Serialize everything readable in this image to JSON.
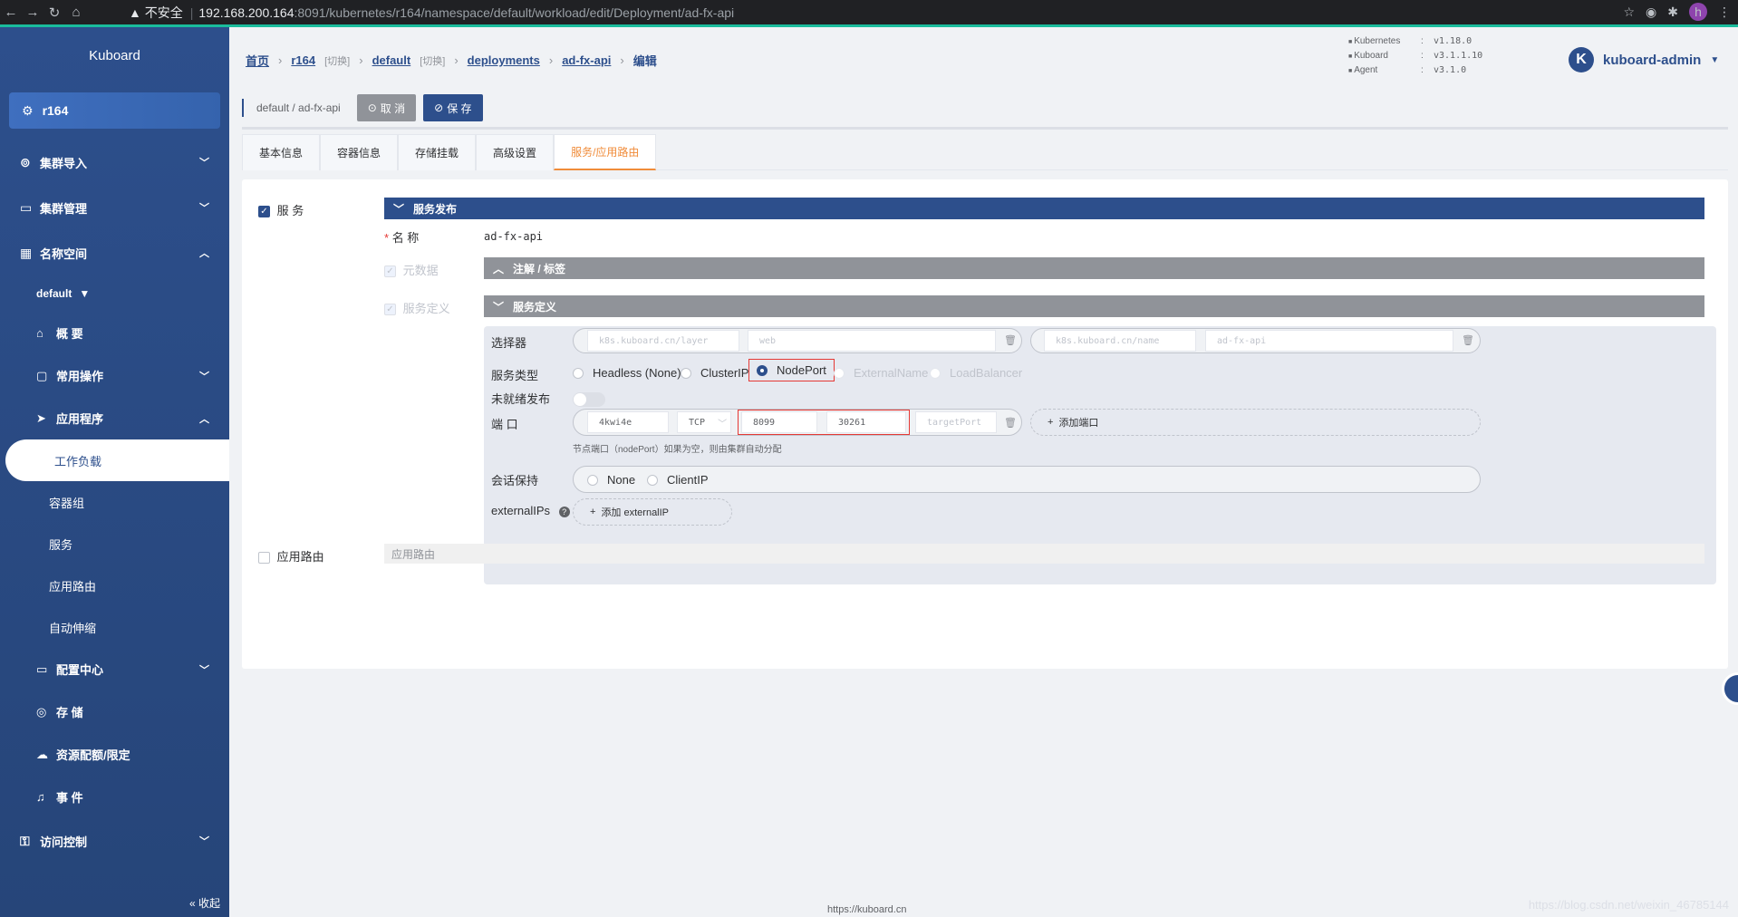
{
  "browser": {
    "back_icon": "arrow-left-icon",
    "forward_icon": "arrow-right-icon",
    "reload_icon": "reload-icon",
    "home_icon": "home-icon",
    "security_label": "不安全",
    "url_host": "192.168.200.164",
    "url_path": ":8091/kubernetes/r164/namespace/default/workload/edit/Deployment/ad-fx-api",
    "profile_initial": "h"
  },
  "sidebar": {
    "brand": "Kuboard",
    "cluster": "r164",
    "items": {
      "cluster_import": "集群导入",
      "cluster_manage": "集群管理",
      "namespace": "名称空间",
      "ns_current": "default",
      "overview": "概 要",
      "common_ops": "常用操作",
      "apps": "应用程序",
      "workload": "工作负载",
      "pods": "容器组",
      "services": "服务",
      "ingress": "应用路由",
      "autoscale": "自动伸缩",
      "config_center": "配置中心",
      "storage": "存 储",
      "quota": "资源配额/限定",
      "events": "事 件",
      "access_control": "访问控制",
      "collapse": "« 收起"
    }
  },
  "breadcrumb": {
    "home": "首页",
    "cluster": "r164",
    "switch_hint": "[切换]",
    "namespace": "default",
    "deployments": "deployments",
    "name": "ad-fx-api",
    "current": "编辑"
  },
  "versions": [
    {
      "k": "Kubernetes",
      "v": "v1.18.0"
    },
    {
      "k": "Kuboard",
      "v": "v3.1.1.10"
    },
    {
      "k": "Agent",
      "v": "v3.1.0"
    }
  ],
  "user": {
    "logo": "K",
    "name": "kuboard-admin"
  },
  "actions": {
    "path": "default / ad-fx-api",
    "cancel": "取 消",
    "save": "保 存"
  },
  "tabs": [
    "基本信息",
    "容器信息",
    "存储挂载",
    "高级设置",
    "服务/应用路由"
  ],
  "form": {
    "service_checkbox": "服 务",
    "service_publish": "服务发布",
    "name_label": "名 称",
    "name_value": "ad-fx-api",
    "metadata_label": "元数据",
    "annotations_header": "注解 / 标签",
    "svcdef_label": "服务定义",
    "svcdef_header": "服务定义",
    "selector_label": "选择器",
    "selector": [
      {
        "key": "k8s.kuboard.cn/layer",
        "value": "web"
      },
      {
        "key": "k8s.kuboard.cn/name",
        "value": "ad-fx-api"
      }
    ],
    "type_label": "服务类型",
    "types": [
      "Headless (None)",
      "ClusterIP",
      "NodePort",
      "ExternalName",
      "LoadBalancer"
    ],
    "unready_label": "未就绪发布",
    "port_label": "端 口",
    "port": {
      "name": "4kwi4e",
      "protocol": "TCP",
      "port": "8099",
      "nodePort": "30261",
      "targetPort_placeholder": "targetPort"
    },
    "add_port": "添加端口",
    "port_hint": "节点端口（nodePort）如果为空，则由集群自动分配",
    "session_label": "会话保持",
    "session_options": [
      "None",
      "ClientIP"
    ],
    "external_label": "externalIPs",
    "add_external": "添加 externalIP",
    "ingress_checkbox": "应用路由",
    "ingress_bar": "应用路由"
  },
  "footer": {
    "url": "https://kuboard.cn",
    "watermark": "https://blog.csdn.net/weixin_46785144"
  },
  "colors": {
    "primary": "#2d4f8c",
    "active_tab": "#f08c3a",
    "highlight_border": "#e53935"
  }
}
